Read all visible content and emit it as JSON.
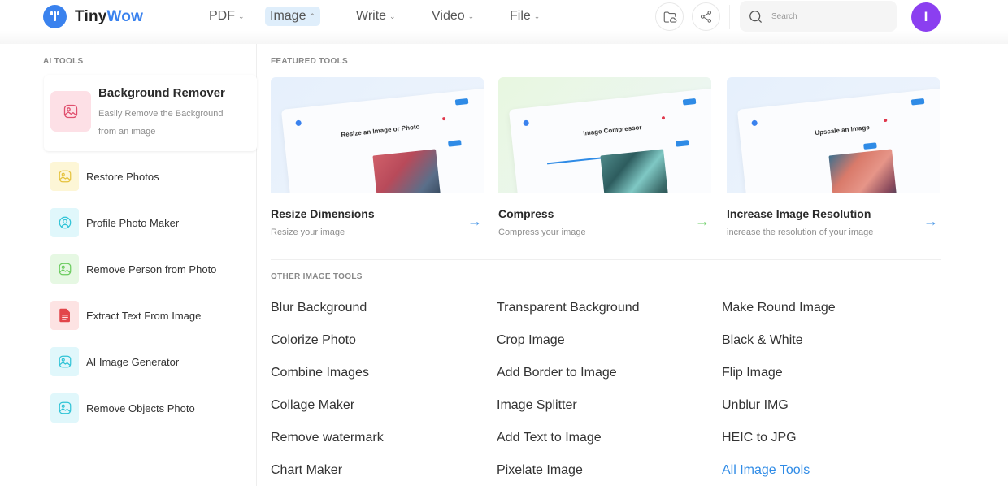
{
  "header": {
    "logo": {
      "part1": "Tiny",
      "part2": "Wow"
    },
    "nav": [
      {
        "label": "PDF",
        "chevron": "⌄",
        "active": false
      },
      {
        "label": "Image",
        "chevron": "^",
        "active": true
      },
      {
        "label": "Write",
        "chevron": "⌄",
        "active": false
      },
      {
        "label": "Video",
        "chevron": "⌄",
        "active": false
      },
      {
        "label": "File",
        "chevron": "⌄",
        "active": false
      }
    ],
    "icons": {
      "folder": "folder-cloud-icon",
      "share": "share-icon",
      "search": "search-icon"
    },
    "search_placeholder": "Search",
    "avatar_initial": "I"
  },
  "colors": {
    "brand": "#3a82ee",
    "accent_link": "#2f8be6",
    "avatar": "#8b3ff0",
    "arrow_blue": "#4a97e6",
    "arrow_green": "#6fcf6a"
  },
  "ai_tools": {
    "label": "AI TOOLS",
    "featured": {
      "title": "Background Remover",
      "description": "Easily Remove the Background from an image",
      "icon": "image-icon"
    },
    "items": [
      {
        "label": "Restore Photos",
        "icon": "image-icon"
      },
      {
        "label": "Profile Photo Maker",
        "icon": "user-circle-icon"
      },
      {
        "label": "Remove Person from Photo",
        "icon": "image-icon"
      },
      {
        "label": "Extract Text From Image",
        "icon": "document-icon"
      },
      {
        "label": "AI Image Generator",
        "icon": "image-icon"
      },
      {
        "label": "Remove Objects Photo",
        "icon": "image-icon"
      }
    ]
  },
  "featured_tools": {
    "label": "FEATURED TOOLS",
    "items": [
      {
        "title": "Resize Dimensions",
        "subtitle": "Resize your image",
        "preview_heading": "Resize an Image or Photo",
        "arrow": "→"
      },
      {
        "title": "Compress",
        "subtitle": "Compress your image",
        "preview_heading": "Image Compressor",
        "arrow": "→"
      },
      {
        "title": "Increase Image Resolution",
        "subtitle": "increase the resolution of your image",
        "preview_heading": "Upscale an Image",
        "arrow": "→"
      }
    ]
  },
  "other_tools": {
    "label": "OTHER IMAGE TOOLS",
    "columns": [
      [
        "Blur Background",
        "Colorize Photo",
        "Combine Images",
        "Collage Maker",
        "Remove watermark",
        "Chart Maker"
      ],
      [
        "Transparent Background",
        "Crop Image",
        "Add Border to Image",
        "Image Splitter",
        "Add Text to Image",
        "Pixelate Image"
      ],
      [
        "Make Round Image",
        "Black & White",
        "Flip Image",
        "Unblur IMG",
        "HEIC to JPG",
        "All Image Tools"
      ]
    ]
  }
}
